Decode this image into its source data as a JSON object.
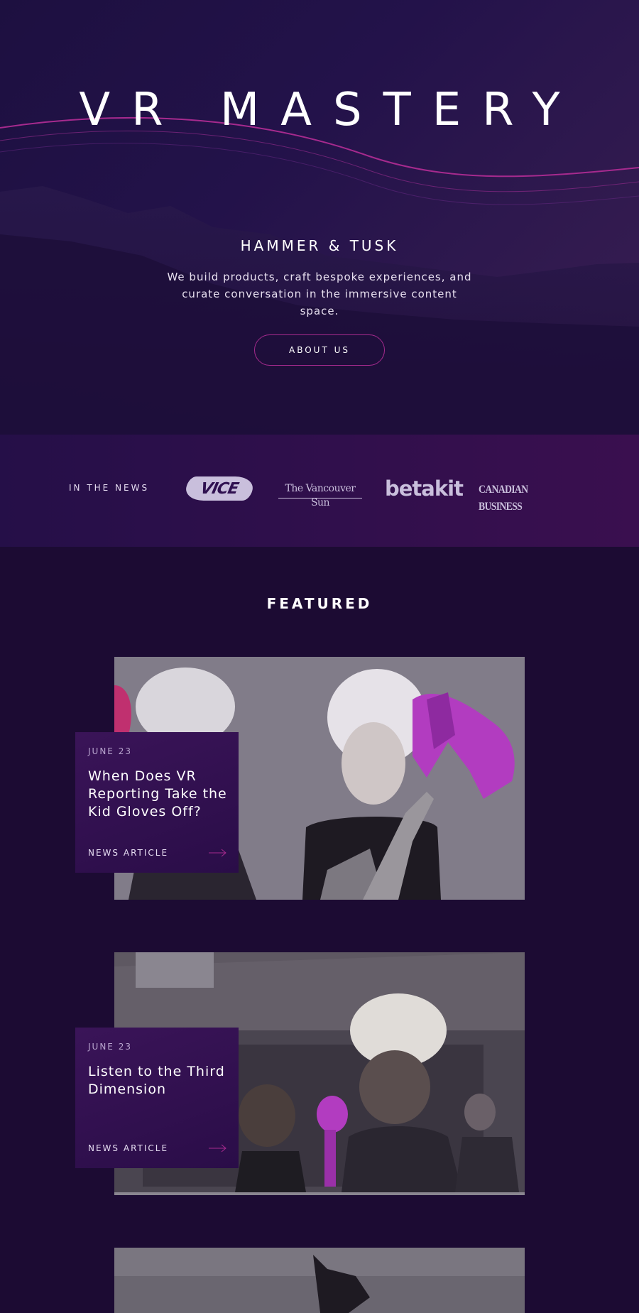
{
  "hero": {
    "title": "VR MASTERY",
    "subtitle": "HAMMER & TUSK",
    "description": "We build products, craft bespoke experiences, and curate conversation in the immersive content space.",
    "button_label": "ABOUT US"
  },
  "news": {
    "label": "IN THE NEWS",
    "logos": [
      {
        "name": "VICE",
        "icon": "vice-logo"
      },
      {
        "name": "The Vancouver Sun",
        "icon": "vancouver-sun-logo"
      },
      {
        "name": "betakit",
        "icon": "betakit-logo"
      },
      {
        "name": "CANADIAN BUSINESS",
        "icon": "canadian-business-logo"
      }
    ]
  },
  "featured": {
    "heading": "FEATURED",
    "articles": [
      {
        "date": "JUNE 23",
        "title": "When Does VR Reporting Take the Kid Gloves Off?",
        "type": "NEWS ARTICLE"
      },
      {
        "date": "JUNE 23",
        "title": "Listen to the Third Dimension",
        "type": "NEWS ARTICLE"
      }
    ]
  },
  "colors": {
    "accent": "#a62a8e",
    "background": "#1c0b33",
    "highlight_magenta": "#b23cc0"
  }
}
